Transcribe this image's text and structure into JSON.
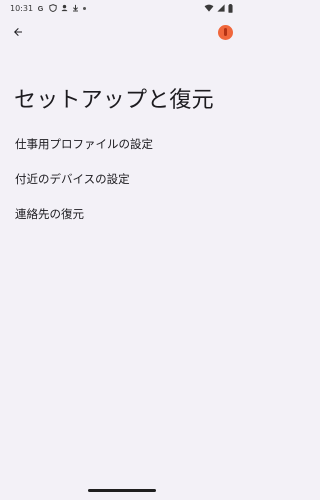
{
  "status_bar": {
    "time": "10:31",
    "left_icons": [
      "google-icon",
      "shield-icon",
      "person-icon",
      "download-icon",
      "dot-icon"
    ],
    "right_icons": [
      "wifi-icon",
      "signal-icon",
      "battery-icon"
    ]
  },
  "app_bar": {
    "back_icon": "arrow-back-icon",
    "record_icon": "screen-record-icon",
    "record_color": "#f0673c"
  },
  "page": {
    "title": "セットアップと復元"
  },
  "menu": {
    "items": [
      {
        "label": "仕事用プロファイルの設定"
      },
      {
        "label": "付近のデバイスの設定"
      },
      {
        "label": "連絡先の復元"
      }
    ]
  }
}
